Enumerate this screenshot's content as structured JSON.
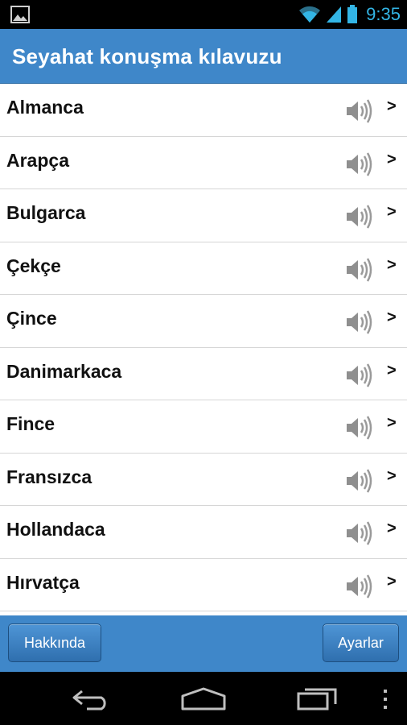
{
  "status_bar": {
    "time": "9:35",
    "icons": [
      "image-icon",
      "wifi-icon",
      "signal-icon",
      "battery-icon"
    ],
    "time_color": "#33b5e5"
  },
  "header": {
    "title": "Seyahat konuşma kılavuzu",
    "background": "#3f87c9"
  },
  "list": {
    "items": [
      {
        "label": "Almanca"
      },
      {
        "label": "Arapça"
      },
      {
        "label": "Bulgarca"
      },
      {
        "label": "Çekçe"
      },
      {
        "label": "Çince"
      },
      {
        "label": "Danimarkaca"
      },
      {
        "label": "Fince"
      },
      {
        "label": "Fransızca"
      },
      {
        "label": "Hollandaca"
      },
      {
        "label": "Hırvatça"
      }
    ],
    "item_icon": "speaker-icon",
    "chevron": ">"
  },
  "footer": {
    "about_label": "Hakkında",
    "settings_label": "Ayarlar"
  },
  "nav_bar": {
    "icons": [
      "back-icon",
      "home-icon",
      "recents-icon",
      "menu-icon"
    ]
  }
}
